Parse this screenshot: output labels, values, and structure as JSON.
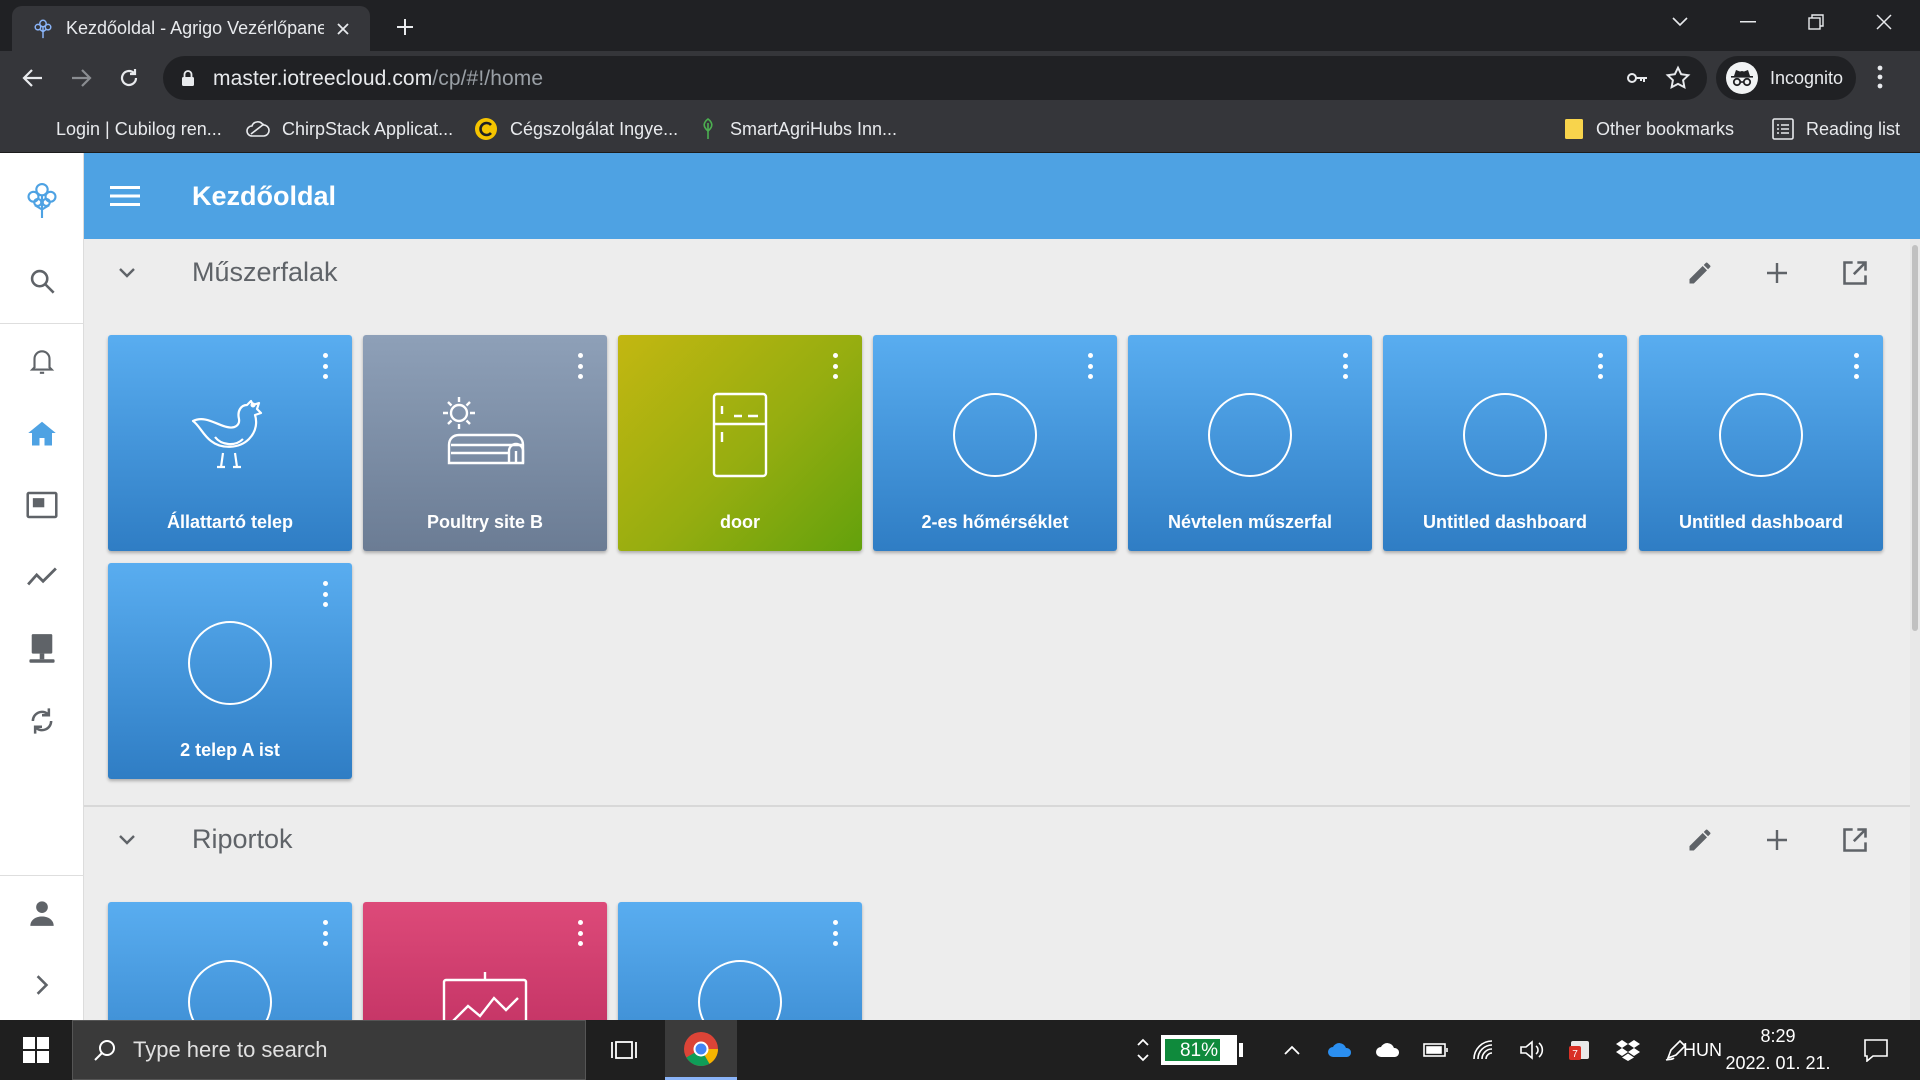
{
  "browser": {
    "tab_title": "Kezdőoldal - Agrigo Vezérlőpanel",
    "url_host": "master.iotreecloud.com",
    "url_path": "/cp/#!/home",
    "profile_label": "Incognito",
    "bookmarks": [
      {
        "label": "Login | Cubilog ren...",
        "icon": "blank-icon"
      },
      {
        "label": "ChirpStack Applicat...",
        "icon": "cloud-icon"
      },
      {
        "label": "Cégszolgálat Ingye...",
        "icon": "yellow-c-icon"
      },
      {
        "label": "SmartAgriHubs Inn...",
        "icon": "tree-icon"
      }
    ],
    "other_bookmarks": "Other bookmarks",
    "reading_list": "Reading list"
  },
  "app": {
    "title": "Kezdőoldal",
    "sections": [
      {
        "title": "Műszerfalak",
        "tiles": [
          {
            "label": "Állattartó telep",
            "icon": "chicken-icon",
            "color": "blue"
          },
          {
            "label": "Poultry site B",
            "icon": "greenhouse-sun-icon",
            "color": "grey"
          },
          {
            "label": "door",
            "icon": "fridge-icon",
            "color": "green"
          },
          {
            "label": "2-es hőmérséklet",
            "icon": "circle-icon",
            "color": "blue"
          },
          {
            "label": "Névtelen műszerfal",
            "icon": "circle-icon",
            "color": "blue"
          },
          {
            "label": "Untitled dashboard",
            "icon": "circle-icon",
            "color": "blue"
          },
          {
            "label": "Untitled dashboard",
            "icon": "circle-icon",
            "color": "blue"
          },
          {
            "label": "2 telep A ist",
            "icon": "circle-icon",
            "color": "blue"
          }
        ]
      },
      {
        "title": "Riportok",
        "tiles": [
          {
            "label": "",
            "icon": "circle-icon",
            "color": "blue"
          },
          {
            "label": "",
            "icon": "chart-board-icon",
            "color": "pink"
          },
          {
            "label": "",
            "icon": "circle-icon",
            "color": "blue"
          }
        ]
      }
    ]
  },
  "taskbar": {
    "search_placeholder": "Type here to search",
    "battery_percent": "81%",
    "battery_level": 0.81,
    "language": "HUN",
    "time": "8:29",
    "date": "2022. 01. 21."
  },
  "colors": {
    "accent": "#4ea2e3",
    "tile_blue": "#3d8fd6",
    "tile_grey": "#7d8ea6",
    "tile_green": "#95ad10",
    "tile_pink": "#c93366"
  }
}
